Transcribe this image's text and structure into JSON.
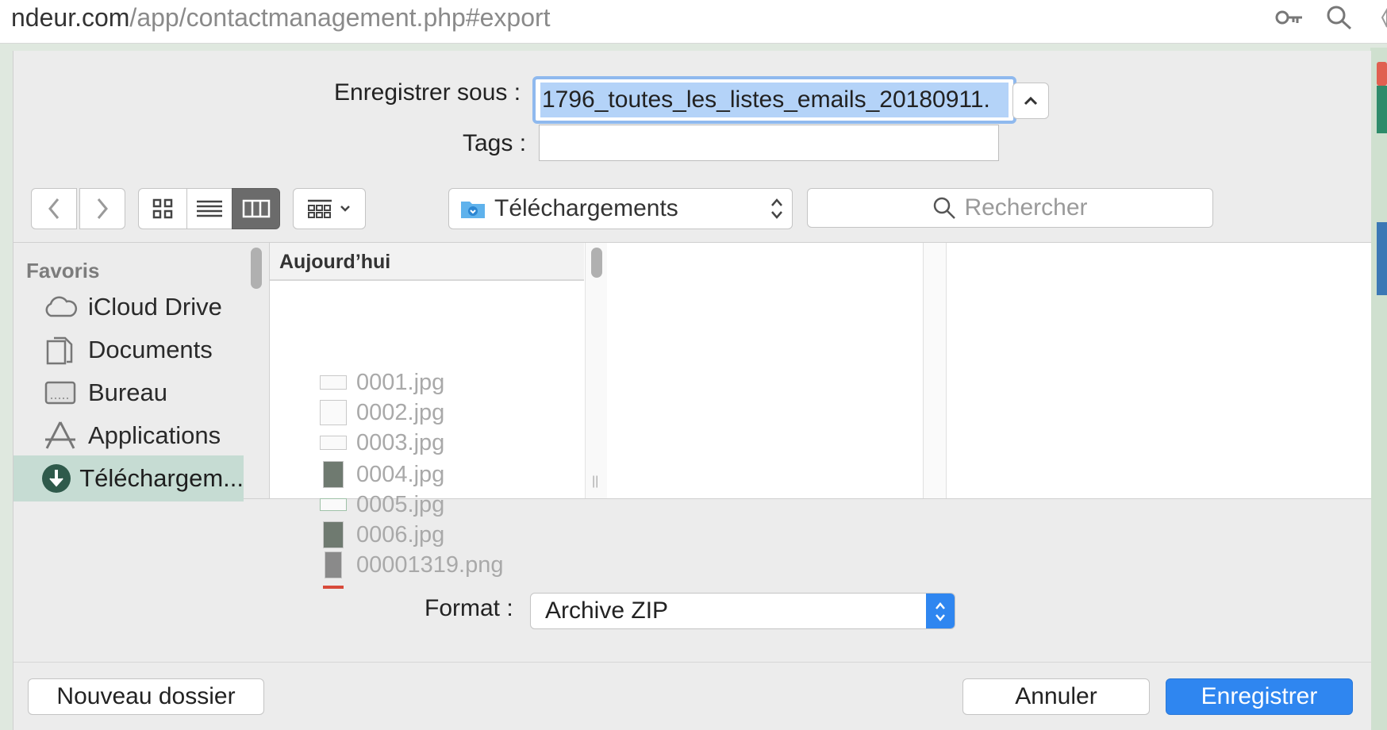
{
  "browser": {
    "url_prefix": "ndeur.com",
    "url_path": "/app/contactmanagement.php#export",
    "key_icon": "key-icon",
    "search_icon": "magnifier-icon"
  },
  "dialog": {
    "save_as_label": "Enregistrer sous :",
    "filename_value": "1796_toutes_les_listes_emails_20180911.",
    "tags_label": "Tags :",
    "tags_value": "",
    "location": "Téléchargements",
    "search_placeholder": "Rechercher",
    "format_label": "Format :",
    "format_value": "Archive ZIP",
    "new_folder_button": "Nouveau dossier",
    "cancel_button": "Annuler",
    "save_button": "Enregistrer"
  },
  "sidebar": {
    "section": "Favoris",
    "items": [
      {
        "label": "iCloud Drive",
        "icon": "cloud-icon"
      },
      {
        "label": "Documents",
        "icon": "documents-icon"
      },
      {
        "label": "Bureau",
        "icon": "desktop-icon"
      },
      {
        "label": "Applications",
        "icon": "applications-icon"
      },
      {
        "label": "Téléchargem...",
        "icon": "downloads-icon",
        "selected": true
      }
    ]
  },
  "column": {
    "header": "Aujourd’hui",
    "files": [
      "0001.jpg",
      "0002.jpg",
      "0003.jpg",
      "0004.jpg",
      "0005.jpg",
      "0006.jpg",
      "00001319.png"
    ]
  },
  "colors": {
    "accent": "#2f86f0",
    "selected_sidebar": "#c6dcd3",
    "dialog_bg": "#ececec"
  }
}
